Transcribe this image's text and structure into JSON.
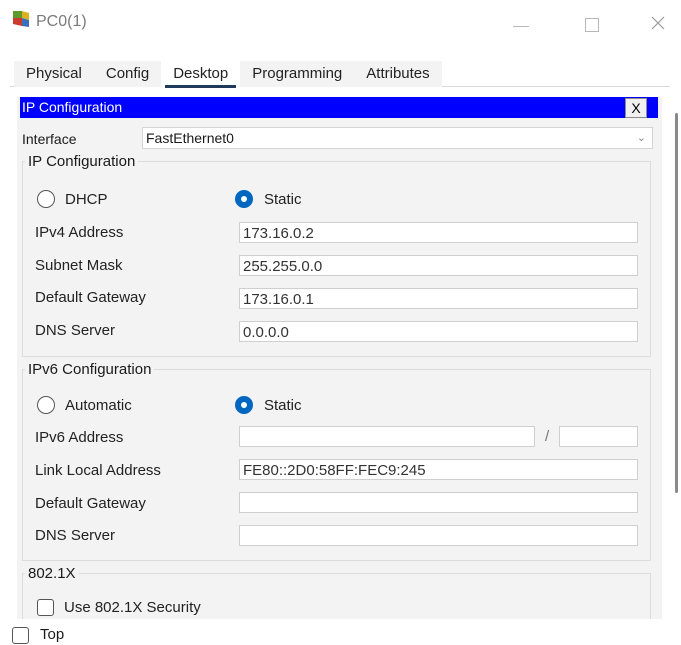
{
  "window": {
    "title": "PC0(1)",
    "icon": "packet-tracer-pc-icon"
  },
  "tabs": [
    {
      "label": "Physical"
    },
    {
      "label": "Config"
    },
    {
      "label": "Desktop",
      "active": true
    },
    {
      "label": "Programming"
    },
    {
      "label": "Attributes"
    }
  ],
  "panel": {
    "title": "IP Configuration",
    "close_label": "X",
    "interface_label": "Interface",
    "interface_value": "FastEthernet0"
  },
  "ipv4": {
    "group_title": "IP Configuration",
    "dhcp_label": "DHCP",
    "static_label": "Static",
    "mode": "Static",
    "address_label": "IPv4 Address",
    "address_value": "173.16.0.2",
    "mask_label": "Subnet Mask",
    "mask_value": "255.255.0.0",
    "gateway_label": "Default Gateway",
    "gateway_value": "173.16.0.1",
    "dns_label": "DNS Server",
    "dns_value": "0.0.0.0"
  },
  "ipv6": {
    "group_title": "IPv6 Configuration",
    "auto_label": "Automatic",
    "static_label": "Static",
    "mode": "Static",
    "address_label": "IPv6 Address",
    "address_value": "",
    "prefix_sep": "/",
    "prefix_value": "",
    "link_local_label": "Link Local Address",
    "link_local_value": "FE80::2D0:58FF:FEC9:245",
    "gateway_label": "Default Gateway",
    "gateway_value": "",
    "dns_label": "DNS Server",
    "dns_value": ""
  },
  "dot1x": {
    "group_title": "802.1X",
    "use_label": "Use 802.1X Security",
    "checked": false
  },
  "footer": {
    "top_label": "Top",
    "checked": false
  },
  "colors": {
    "header_bg": "#0000ff",
    "radio_selected": "#0067c0",
    "tab_underline": "#1f3a5a"
  }
}
